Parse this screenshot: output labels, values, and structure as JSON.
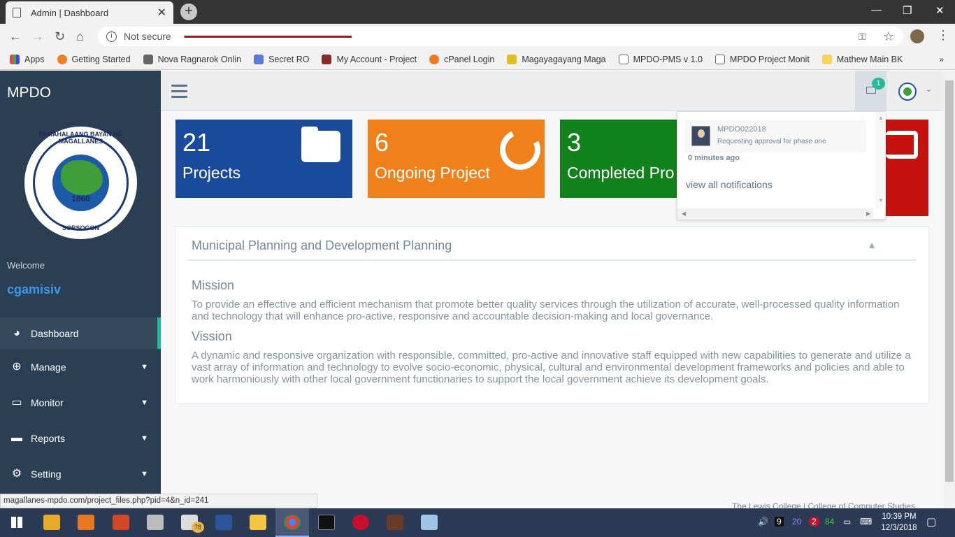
{
  "browser": {
    "tab_title": "Admin | Dashboard",
    "address": "Not secure",
    "bookmarks": [
      "Apps",
      "Getting Started",
      "Nova Ragnarok Onlin",
      "Secret RO",
      "My Account - Project",
      "cPanel Login",
      "Magayagayang Maga",
      "MPDO-PMS v 1.0",
      "MPDO Project Monit",
      "Mathew Main BK"
    ],
    "status_url": "magallanes-mpdo.com/project_files.php?pid=4&n_id=241"
  },
  "sidebar": {
    "brand": "MPDO",
    "logo_top": "PAMAHALAANG BAYAN NG MAGALLANES",
    "logo_year": "1860",
    "logo_bottom": "SORSOGON",
    "welcome": "Welcome",
    "username": "cgamisiv",
    "menu": [
      {
        "label": "Dashboard",
        "icon": "dashboard-icon"
      },
      {
        "label": "Manage",
        "icon": "plus-circle-icon"
      },
      {
        "label": "Monitor",
        "icon": "monitor-icon"
      },
      {
        "label": "Reports",
        "icon": "folder-icon"
      },
      {
        "label": "Setting",
        "icon": "gear-icon"
      }
    ]
  },
  "header": {
    "notification_count": "1"
  },
  "tiles": [
    {
      "number": "21",
      "label": "Projects",
      "color": "#1a4a9c"
    },
    {
      "number": "6",
      "label": "Ongoing Project",
      "color": "#f0801a"
    },
    {
      "number": "3",
      "label": "Completed Pro",
      "color": "#12821c"
    }
  ],
  "notifications": {
    "user": "MPDO022018",
    "message": "Requesting approval for phase one",
    "time": "0 minutes ago",
    "view_all": "view all notifications"
  },
  "panel": {
    "title": "Municipal Planning and Development Planning",
    "mission_heading": "Mission",
    "mission_text": "To provide an effective and efficient mechanism that promote better quality services through the utilization of accurate, well-processed quality information and technology that will enhance pro-active, responsive and accountable decision-making and local governance.",
    "vision_heading": "Vission",
    "vision_text": "A dynamic and responsive organization with responsible, committed, pro-active and innovative staff equipped with new capabilities to generate and utilize a vast array of information and technology to evolve socio-economic, physical, cultural and environmental development frameworks and policies and able to work harmoniously with other local government functionaries to support the local government achieve its development goals."
  },
  "footer": "The Lewis College | College of Computer Studies",
  "taskbar": {
    "mail_badge": "78",
    "tray_nums": [
      "9",
      "20",
      "2",
      "84"
    ],
    "time": "10:39 PM",
    "date": "12/3/2018"
  }
}
